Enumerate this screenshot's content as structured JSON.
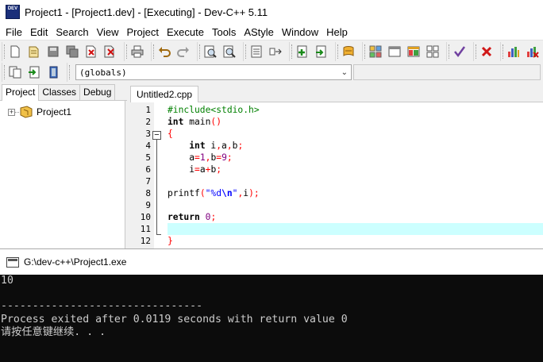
{
  "window": {
    "title": "Project1 - [Project1.dev] - [Executing] - Dev-C++ 5.11",
    "icon_text": "DEV"
  },
  "menu": [
    "File",
    "Edit",
    "Search",
    "View",
    "Project",
    "Execute",
    "Tools",
    "AStyle",
    "Window",
    "Help"
  ],
  "toolbar": {
    "globals_value": "(globals)",
    "icons": [
      "new-file-icon",
      "open-file-icon",
      "save-icon",
      "save-all-icon",
      "close-icon",
      "close-all-icon",
      "print-icon",
      "undo-icon",
      "redo-icon",
      "find-icon",
      "replace-icon",
      "indent-icon",
      "unindent-icon",
      "goto-icon",
      "bookmark-icon",
      "compile-icon",
      "run-icon",
      "compile-run-icon",
      "rebuild-icon",
      "syntax-check-icon",
      "stop-icon",
      "profile-icon",
      "delete-profile-icon",
      "new-project-icon",
      "add-file-icon",
      "remove-file-icon"
    ]
  },
  "side_panel": {
    "tabs": [
      "Project",
      "Classes",
      "Debug"
    ],
    "active_tab": "Project",
    "tree": {
      "expand_symbol": "+",
      "project_name": "Project1"
    }
  },
  "editor": {
    "file_tab": "Untitled2.cpp",
    "line_numbers": [
      "1",
      "2",
      "3",
      "4",
      "5",
      "6",
      "7",
      "8",
      "9",
      "10",
      "11",
      "12"
    ],
    "active_line": 11,
    "lines": {
      "l1": "#include<stdio.h>",
      "l2_kw": "int",
      "l2_rest": " main",
      "l2_paren": "()",
      "l3": "{",
      "l4_kw": "int",
      "l4_a": " i",
      "l4_c1": ",",
      "l4_b": "a",
      "l4_c2": ",",
      "l4_d": "b",
      "l4_semi": ";",
      "l5_a": "a",
      "l5_eq1": "=",
      "l5_n1": "1",
      "l5_c": ",",
      "l5_b": "b",
      "l5_eq2": "=",
      "l5_n2": "9",
      "l5_semi": ";",
      "l6_i": "i",
      "l6_eq": "=",
      "l6_a": "a",
      "l6_plus": "+",
      "l6_b": "b",
      "l6_semi": ";",
      "l8_fn": "printf",
      "l8_open": "(",
      "l8_q1": "\"%d",
      "l8_esc": "\\n",
      "l8_q2": "\"",
      "l8_c": ",",
      "l8_i": "i",
      "l8_close": ");",
      "l10_kw": "return",
      "l10_n": "0",
      "l10_semi": ";",
      "l12": "}"
    }
  },
  "console": {
    "title": "G:\\dev-c++\\Project1.exe",
    "lines": [
      "10",
      "",
      "--------------------------------",
      "Process exited after 0.0119 seconds with return value 0",
      "请按任意键继续. . ."
    ]
  }
}
